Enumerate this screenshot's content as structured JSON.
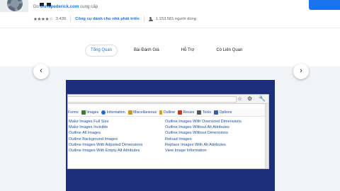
{
  "header": {
    "by_prefix": "Do ",
    "author": "chrispederick.com",
    "by_suffix": " cung cấp",
    "stars": "★★★★☆",
    "rating_count": "3.439",
    "category": "Công cụ dành cho nhà phát triển",
    "users": "1.153.581 người dùng"
  },
  "tabs": [
    {
      "label": "Tổng Quan",
      "active": true
    },
    {
      "label": "Bài Đánh Giá",
      "active": false
    },
    {
      "label": "Hỗ Trợ",
      "active": false
    },
    {
      "label": "Có Liên Quan",
      "active": false
    }
  ],
  "gallery": {
    "prev_glyph": "‹",
    "next_glyph": "›",
    "toolbar_icons": {
      "star": "☆",
      "gear": "⚙",
      "wrench": "🔧"
    },
    "wd_menu": [
      {
        "label": "Forms",
        "icon_color": ""
      },
      {
        "label": "Images",
        "icon_color": "#3c7a2e"
      },
      {
        "label": "Information",
        "icon_color": "#1f6bd1"
      },
      {
        "label": "Miscellaneous",
        "icon_color": "#c7962a"
      },
      {
        "label": "Outline",
        "icon_color": "#d4a017"
      },
      {
        "label": "Resize",
        "icon_color": "#c23a1e"
      },
      {
        "label": "Tools",
        "icon_color": "#555555"
      },
      {
        "label": "Options",
        "icon_color": "#3b5ba8"
      }
    ],
    "commands_left": [
      "Make Images Full Size",
      "Make Images Invisible",
      "Outline All Images",
      "Outline Background Images",
      "Outline Images With Adjusted Dimensions",
      "Outline Images With Empty Alt Attributes"
    ],
    "commands_right": [
      "Outline Images With Oversized Dimensions",
      "Outline Images Without Alt Attributes",
      "Outline Images Without Dimensions",
      "Reload Images",
      "Replace Images With Alt Attributes",
      "View Image Information"
    ]
  }
}
